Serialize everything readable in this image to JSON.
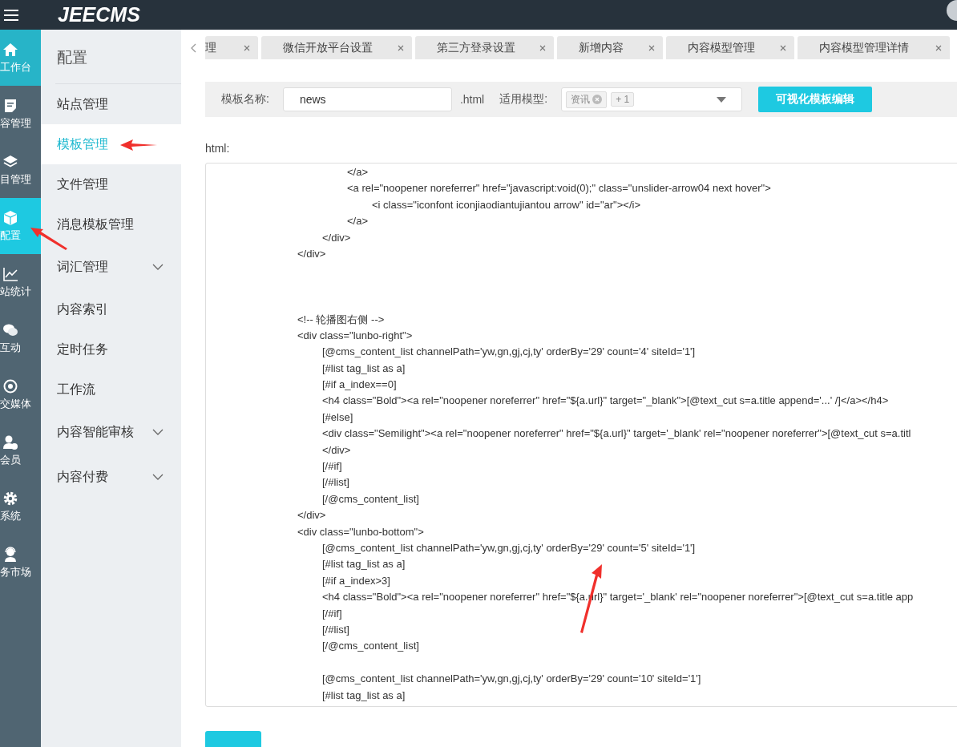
{
  "topbar": {
    "logo": "JEECMS"
  },
  "rail": [
    {
      "label": "工作台",
      "kind": "home",
      "selected": false,
      "highlighted": true
    },
    {
      "label": "容管理",
      "kind": "doc",
      "selected": false,
      "highlighted": false
    },
    {
      "label": "目管理",
      "kind": "layers",
      "selected": false,
      "highlighted": false
    },
    {
      "label": "配置",
      "kind": "cube",
      "selected": true,
      "highlighted": false
    },
    {
      "label": "站统计",
      "kind": "chart",
      "selected": false,
      "highlighted": false
    },
    {
      "label": "互动",
      "kind": "chat",
      "selected": false,
      "highlighted": false
    },
    {
      "label": "交媒体",
      "kind": "target",
      "selected": false,
      "highlighted": false
    },
    {
      "label": "会员",
      "kind": "user",
      "selected": false,
      "highlighted": false
    },
    {
      "label": "系统",
      "kind": "gear",
      "selected": false,
      "highlighted": false
    },
    {
      "label": "务市场",
      "kind": "headset",
      "selected": false,
      "highlighted": false
    }
  ],
  "sidebar": {
    "title": "配置",
    "items": [
      {
        "label": "站点管理",
        "selected": false,
        "expandable": false
      },
      {
        "label": "模板管理",
        "selected": true,
        "expandable": false
      },
      {
        "label": "文件管理",
        "selected": false,
        "expandable": false
      },
      {
        "label": "消息模板管理",
        "selected": false,
        "expandable": false
      },
      {
        "label": "词汇管理",
        "selected": false,
        "expandable": true
      },
      {
        "label": "内容索引",
        "selected": false,
        "expandable": false
      },
      {
        "label": "定时任务",
        "selected": false,
        "expandable": false
      },
      {
        "label": "工作流",
        "selected": false,
        "expandable": false
      },
      {
        "label": "内容智能审核",
        "selected": false,
        "expandable": true
      },
      {
        "label": "内容付费",
        "selected": false,
        "expandable": true
      }
    ]
  },
  "tabs": [
    {
      "label": "理",
      "selected": false
    },
    {
      "label": "微信开放平台设置",
      "selected": false
    },
    {
      "label": "第三方登录设置",
      "selected": false
    },
    {
      "label": "新增内容",
      "selected": false
    },
    {
      "label": "内容模型管理",
      "selected": false
    },
    {
      "label": "内容模型管理详情",
      "selected": false
    }
  ],
  "form": {
    "name_label": "模板名称:",
    "name_value": "news",
    "suffix": ".html",
    "model_label": "适用模型:",
    "model_tags": [
      "资讯"
    ],
    "model_more": "+ 1",
    "visual_button": "可视化模板编辑"
  },
  "editor": {
    "label": "html:",
    "code": "\t\t</a>\n\t\t<a rel=\"noopener noreferrer\" href=\"javascript:void(0);\" class=\"unslider-arrow04 next hover\">\n\t\t\t<i class=\"iconfont iconjiaodiantujiantou arrow\" id=\"ar\"></i>\n\t\t</a>\n\t</div>\n</div>\n\n\n\n<!-- 轮播图右侧 -->\n<div class=\"lunbo-right\">\n\t[@cms_content_list channelPath='yw,gn,gj,cj,ty' orderBy='29' count='4' siteId='1']\n\t[#list tag_list as a]\n\t[#if a_index==0]\n\t<h4 class=\"Bold\"><a rel=\"noopener noreferrer\" href=\"${a.url}\" target=\"_blank\">[@text_cut s=a.title append='...' /]</a></h4>\n\t[#else]\n\t<div class=\"Semilight\"><a rel=\"noopener noreferrer\" href=\"${a.url}\" target='_blank' rel=\"noopener noreferrer\">[@text_cut s=a.titl\n\t</div>\n\t[/#if]\n\t[/#list]\n\t[/@cms_content_list]\n</div>\n<div class=\"lunbo-bottom\">\n\t[@cms_content_list channelPath='yw,gn,gj,cj,ty' orderBy='29' count='5' siteId='1']\n\t[#list tag_list as a]\n\t[#if a_index>3]\n\t<h4 class=\"Bold\"><a rel=\"noopener noreferrer\" href=\"${a.url}\" target='_blank' rel=\"noopener noreferrer\">[@text_cut s=a.title app\n\t[/#if]\n\t[/#list]\n\t[/@cms_content_list]\n\n\t[@cms_content_list channelPath='yw,gn,gj,cj,ty' orderBy='29' count='10' siteId='1']\n\t[#list tag_list as a]"
  }
}
